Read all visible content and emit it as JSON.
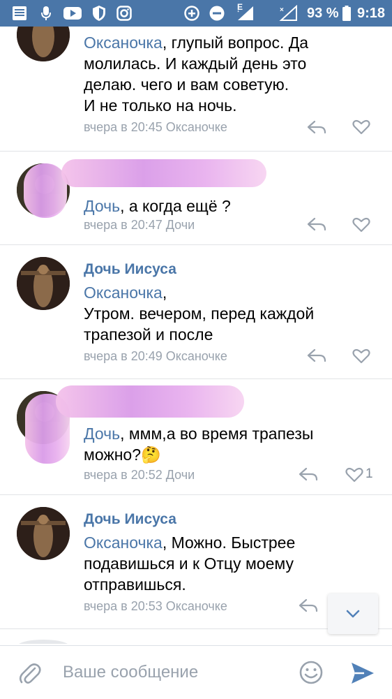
{
  "status_bar": {
    "icons": [
      "news-icon",
      "mic-icon",
      "youtube-icon",
      "shield-icon",
      "instagram-icon",
      "data-saver-icon",
      "do-not-disturb-icon",
      "signal-icon",
      "signal-no-data-icon"
    ],
    "network_label": "E",
    "battery": "93 %",
    "time": "9:18"
  },
  "comments": [
    {
      "author": "",
      "mention": "Оксаночка",
      "text_lines": [
        ", глупый вопрос. Да",
        "молилась. И каждый день это",
        "делаю. чего и вам советую.",
        "И не только на ночь."
      ],
      "meta": "вчера в 20:45 Оксаночке",
      "likes": ""
    },
    {
      "author": "",
      "mention": "Дочь",
      "text_lines": [
        ", а когда ещё ?"
      ],
      "meta": "вчера в 20:47 Дочи",
      "likes": ""
    },
    {
      "author": "Дочь Иисуса",
      "mention": "Оксаночка",
      "text_lines": [
        ",",
        "Утром. вечером, перед каждой",
        "трапезой и после"
      ],
      "meta": "вчера в 20:49 Оксаночке",
      "likes": ""
    },
    {
      "author": "",
      "mention": "Дочь",
      "text_lines": [
        ", ммм,а во время трапезы",
        "можно?🤔"
      ],
      "meta": "вчера в 20:52 Дочи",
      "likes": "1"
    },
    {
      "author": "Дочь Иисуса",
      "mention": "Оксаночка",
      "text_lines": [
        ", Можно. Быстрее",
        "подавишься и к Отцу моему",
        "отправишься."
      ],
      "meta": "вчера в 20:53 Оксаночке",
      "likes": ""
    }
  ],
  "input": {
    "placeholder": "Ваше сообщение"
  },
  "colors": {
    "brand": "#4a76a8",
    "meta": "#99a2ad",
    "send": "#5181b8"
  }
}
